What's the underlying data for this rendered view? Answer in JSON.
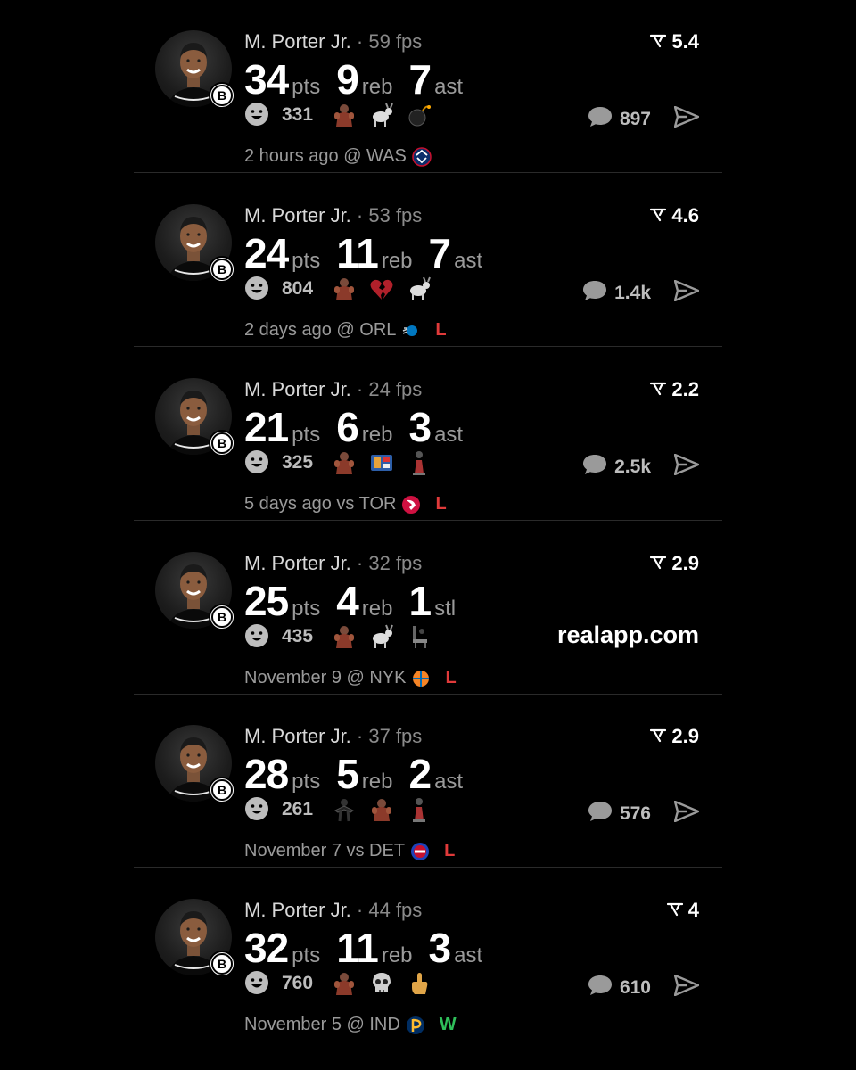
{
  "colors": {
    "background": "#000000",
    "loss": "#e03a3a",
    "win": "#2fbf5a",
    "muted": "#9a9a9a"
  },
  "cards": [
    {
      "player": "M. Porter Jr.",
      "fps": "59 fps",
      "rating": "5.4",
      "stats": [
        {
          "v": "34",
          "l": "pts"
        },
        {
          "v": "9",
          "l": "reb"
        },
        {
          "v": "7",
          "l": "ast"
        }
      ],
      "reaction_count": "331",
      "emojis": [
        "flexed-figure",
        "goat",
        "bomb"
      ],
      "comment_count": "897",
      "time": "2 hours ago @ WAS",
      "team_logo": "wizards-logo",
      "result": ""
    },
    {
      "player": "M. Porter Jr.",
      "fps": "53 fps",
      "rating": "4.6",
      "stats": [
        {
          "v": "24",
          "l": "pts"
        },
        {
          "v": "11",
          "l": "reb"
        },
        {
          "v": "7",
          "l": "ast"
        }
      ],
      "reaction_count": "804",
      "emojis": [
        "flexed-figure",
        "broken-heart",
        "goat"
      ],
      "comment_count": "1.4k",
      "time": "2 days ago @ ORL",
      "team_logo": "magic-logo",
      "result": "L"
    },
    {
      "player": "M. Porter Jr.",
      "fps": "24 fps",
      "rating": "2.2",
      "stats": [
        {
          "v": "21",
          "l": "pts"
        },
        {
          "v": "6",
          "l": "reb"
        },
        {
          "v": "3",
          "l": "ast"
        }
      ],
      "reaction_count": "325",
      "emojis": [
        "flexed-figure",
        "sticker",
        "statue"
      ],
      "comment_count": "2.5k",
      "time": "5 days ago vs TOR",
      "team_logo": "raptors-logo",
      "result": "L"
    },
    {
      "player": "M. Porter Jr.",
      "fps": "32 fps",
      "rating": "2.9",
      "stats": [
        {
          "v": "25",
          "l": "pts"
        },
        {
          "v": "4",
          "l": "reb"
        },
        {
          "v": "1",
          "l": "stl"
        }
      ],
      "reaction_count": "435",
      "emojis": [
        "flexed-figure",
        "goat",
        "chair"
      ],
      "comment_count": "",
      "watermark": "realapp.com",
      "time": "November 9 @ NYK",
      "team_logo": "knicks-logo",
      "result": "L"
    },
    {
      "player": "M. Porter Jr.",
      "fps": "37 fps",
      "rating": "2.9",
      "stats": [
        {
          "v": "28",
          "l": "pts"
        },
        {
          "v": "5",
          "l": "reb"
        },
        {
          "v": "2",
          "l": "ast"
        }
      ],
      "reaction_count": "261",
      "emojis": [
        "dark-figure",
        "flexed-figure",
        "statue"
      ],
      "comment_count": "576",
      "time": "November 7 vs DET",
      "team_logo": "pistons-logo",
      "result": "L"
    },
    {
      "player": "M. Porter Jr.",
      "fps": "44 fps",
      "rating": "4",
      "stats": [
        {
          "v": "32",
          "l": "pts"
        },
        {
          "v": "11",
          "l": "reb"
        },
        {
          "v": "3",
          "l": "ast"
        }
      ],
      "reaction_count": "760",
      "emojis": [
        "flexed-figure",
        "skull",
        "middle-finger"
      ],
      "comment_count": "610",
      "time": "November 5 @ IND",
      "team_logo": "pacers-logo",
      "result": "W"
    }
  ]
}
